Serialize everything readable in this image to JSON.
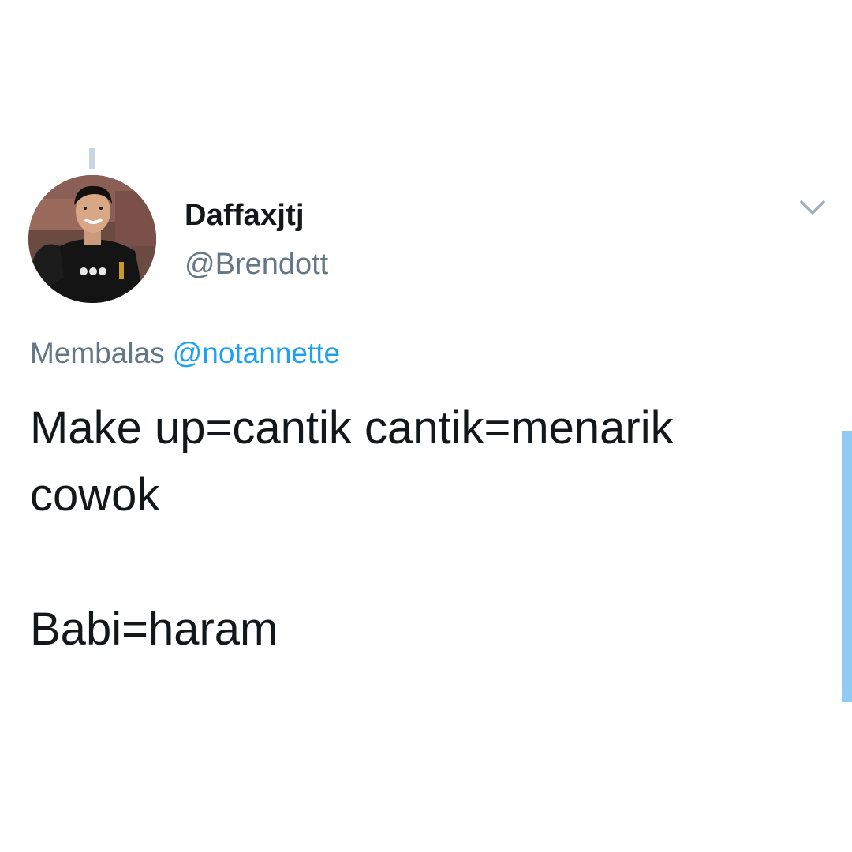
{
  "tweet": {
    "display_name": "Daffaxjtj",
    "handle": "@Brendott",
    "reply_prefix": "Membalas",
    "reply_to": "@notannette",
    "lines": [
      "Make up=cantik cantik=menarik",
      "cowok",
      "Babi=haram"
    ]
  },
  "icons": {
    "menu": "chevron-down-icon",
    "avatar": "profile-photo"
  },
  "colors": {
    "text": "#14171a",
    "secondary": "#657786",
    "link": "#1da1f2",
    "scrollbar": "#8fcbf3"
  }
}
